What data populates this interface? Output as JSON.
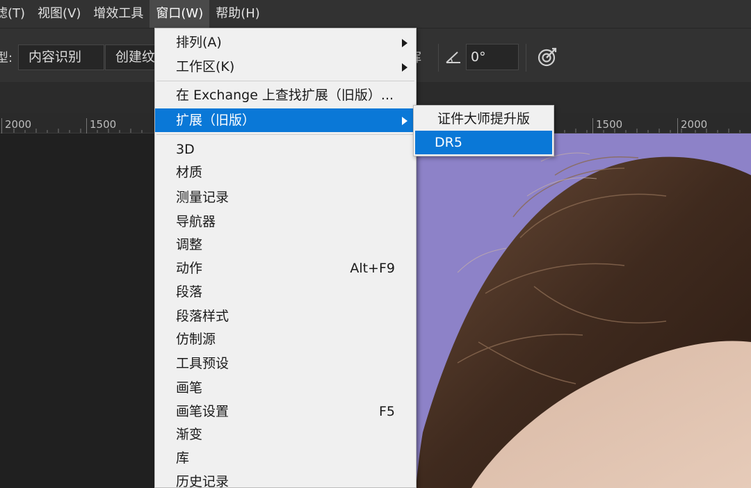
{
  "menubar": {
    "items": [
      {
        "label": "滤(T)"
      },
      {
        "label": "视图(V)"
      },
      {
        "label": "增效工具"
      },
      {
        "label": "窗口(W)"
      },
      {
        "label": "帮助(H)"
      }
    ]
  },
  "options": {
    "type_label": "型:",
    "content_aware": "内容识别",
    "create_texture": "创建纹理",
    "angle_value": "0°"
  },
  "ruler": {
    "labels": [
      "2000",
      "1500",
      "1500",
      "2000"
    ]
  },
  "window_menu": {
    "items": [
      {
        "label": "排列(A)",
        "shortcut": "",
        "submenu": true
      },
      {
        "label": "工作区(K)",
        "shortcut": "",
        "submenu": true
      },
      {
        "label": "在 Exchange 上查找扩展（旧版）...",
        "shortcut": "",
        "submenu": false
      },
      {
        "label": "扩展（旧版）",
        "shortcut": "",
        "submenu": true,
        "highlighted": true
      },
      {
        "label": "3D",
        "shortcut": ""
      },
      {
        "label": "材质",
        "shortcut": ""
      },
      {
        "label": "测量记录",
        "shortcut": ""
      },
      {
        "label": "导航器",
        "shortcut": ""
      },
      {
        "label": "调整",
        "shortcut": ""
      },
      {
        "label": "动作",
        "shortcut": "Alt+F9"
      },
      {
        "label": "段落",
        "shortcut": ""
      },
      {
        "label": "段落样式",
        "shortcut": ""
      },
      {
        "label": "仿制源",
        "shortcut": ""
      },
      {
        "label": "工具预设",
        "shortcut": ""
      },
      {
        "label": "画笔",
        "shortcut": ""
      },
      {
        "label": "画笔设置",
        "shortcut": "F5"
      },
      {
        "label": "渐变",
        "shortcut": ""
      },
      {
        "label": "库",
        "shortcut": ""
      },
      {
        "label": "历史记录",
        "shortcut": ""
      }
    ]
  },
  "extensions_submenu": {
    "items": [
      {
        "label": "证件大师提升版"
      },
      {
        "label": "DR5",
        "highlighted": true
      }
    ]
  },
  "colors": {
    "highlight": "#0a78d7",
    "menu_bg": "#f0f0f0",
    "app_bg": "#323232",
    "photo_bg": "#8f83c9"
  }
}
